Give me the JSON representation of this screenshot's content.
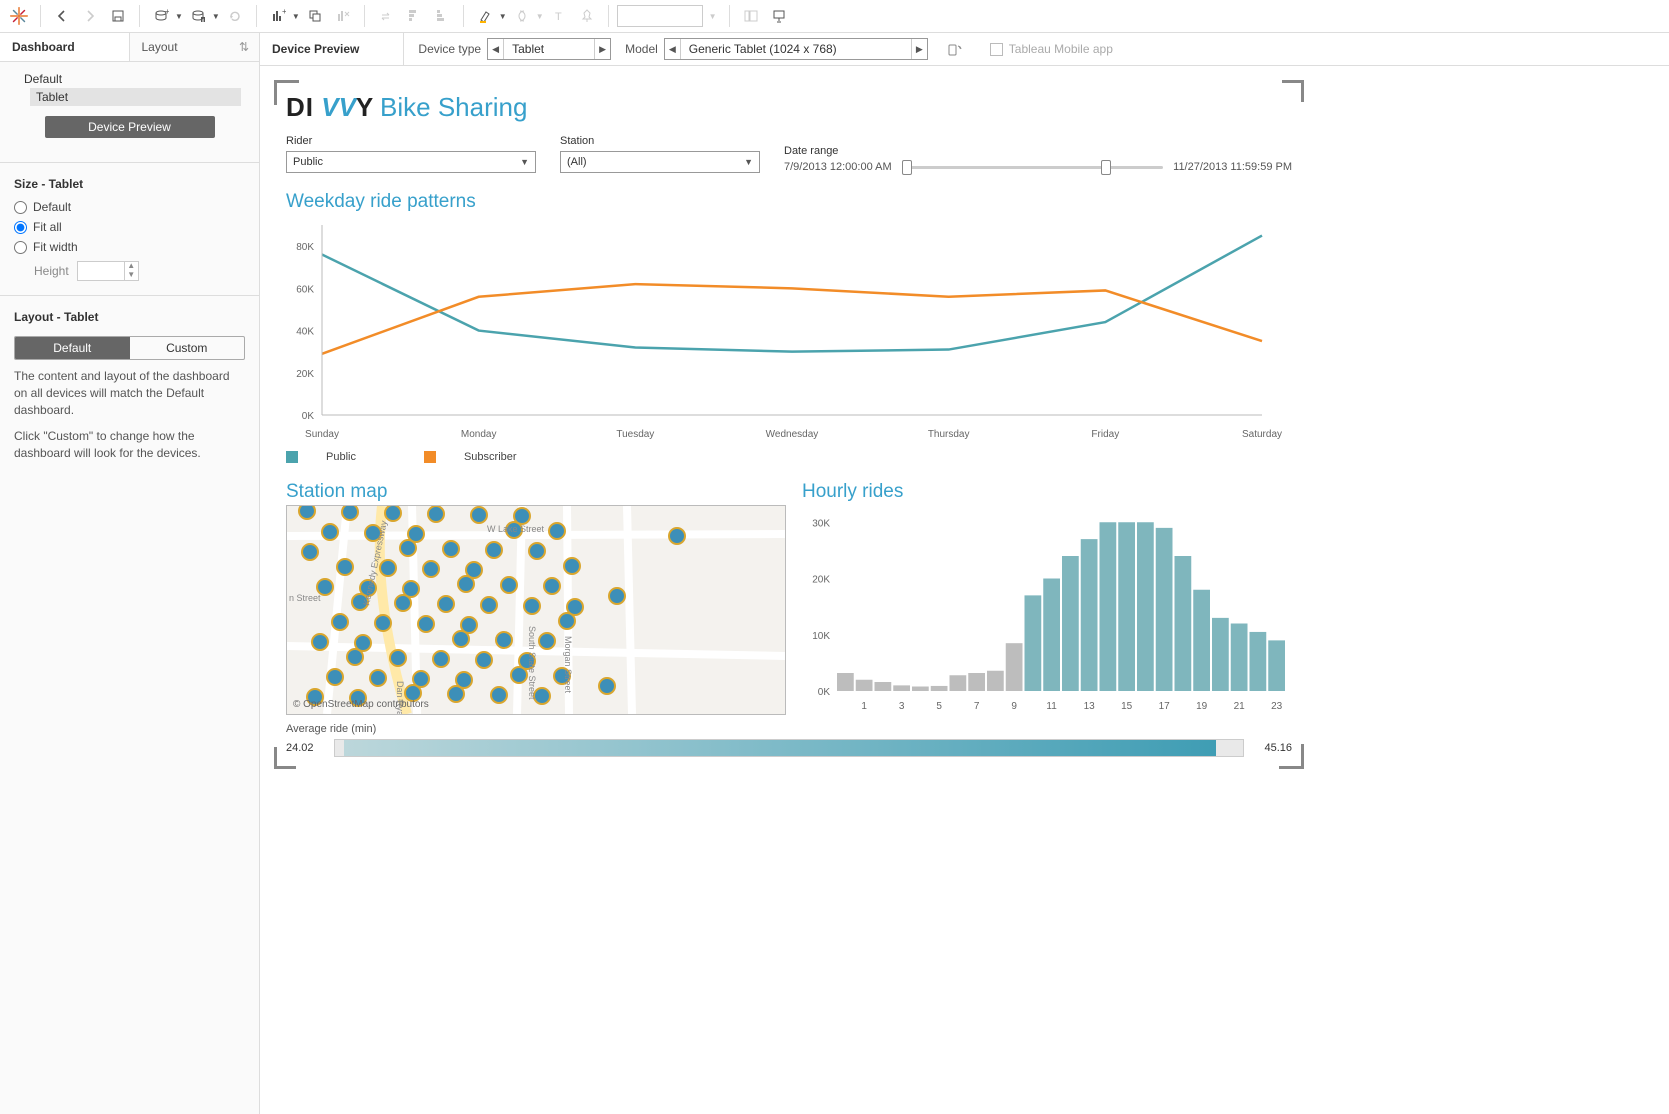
{
  "toolbar": {
    "items": [
      "back",
      "forward",
      "save",
      "new-worksheet",
      "duplicate",
      "refresh",
      "swap",
      "sort-asc",
      "sort-desc"
    ]
  },
  "left_panel": {
    "tabs": {
      "dashboard": "Dashboard",
      "layout": "Layout"
    },
    "device_items": {
      "default": "Default",
      "tablet": "Tablet"
    },
    "preview_button": "Device Preview",
    "size_title": "Size - Tablet",
    "size_options": {
      "default": "Default",
      "fit_all": "Fit all",
      "fit_width": "Fit width"
    },
    "height_label": "Height",
    "layout_title": "Layout - Tablet",
    "layout_toggle": {
      "default": "Default",
      "custom": "Custom"
    },
    "help1": "The content and layout of the dashboard on all devices will match the Default dashboard.",
    "help2": "Click \"Custom\" to change how the dashboard will look for the devices."
  },
  "preview_bar": {
    "title": "Device Preview",
    "device_type_label": "Device type",
    "device_type_value": "Tablet",
    "model_label": "Model",
    "model_value": "Generic Tablet (1024 x 768)",
    "mobile_app": "Tableau Mobile app"
  },
  "dashboard": {
    "title_logo": {
      "di": "DI",
      "vv": " VV",
      "y": "Y ",
      "rest": "Bike Sharing"
    },
    "filters": {
      "rider": {
        "label": "Rider",
        "value": "Public"
      },
      "station": {
        "label": "Station",
        "value": "(All)"
      },
      "date_range": {
        "label": "Date range",
        "start": "7/9/2013 12:00:00 AM",
        "end": "11/27/2013 11:59:59 PM"
      }
    },
    "weekday_title": "Weekday ride patterns",
    "legend": {
      "public": "Public",
      "subscriber": "Subscriber"
    },
    "station_map_title": "Station map",
    "map_credit": "© OpenStreetMap contributors",
    "map_streets": {
      "lake": "W Lake Street",
      "kennedy": "Kennedy Expressway",
      "state": "South State Street",
      "morgan": "Morgan Street",
      "danryan": "Dan Ryan",
      "n": "n Street"
    },
    "hourly_title": "Hourly rides",
    "avg_label": "Average ride (min)",
    "avg_low": "24.02",
    "avg_high": "45.16"
  },
  "chart_data": [
    {
      "type": "line",
      "title": "Weekday ride patterns",
      "categories": [
        "Sunday",
        "Monday",
        "Tuesday",
        "Wednesday",
        "Thursday",
        "Friday",
        "Saturday"
      ],
      "series": [
        {
          "name": "Public",
          "color": "#4ba3ad",
          "values": [
            76000,
            40000,
            32000,
            30000,
            31000,
            44000,
            85000
          ]
        },
        {
          "name": "Subscriber",
          "color": "#f28c28",
          "values": [
            29000,
            56000,
            62000,
            60000,
            56000,
            59000,
            35000
          ]
        }
      ],
      "ylabel": "",
      "xlabel": "",
      "ylim": [
        0,
        90000
      ],
      "yticks": [
        0,
        20000,
        40000,
        60000,
        80000
      ],
      "ytick_labels": [
        "0K",
        "20K",
        "40K",
        "60K",
        "80K"
      ]
    },
    {
      "type": "bar",
      "title": "Hourly rides",
      "categories": [
        0,
        1,
        2,
        3,
        4,
        5,
        6,
        7,
        8,
        9,
        10,
        11,
        12,
        13,
        14,
        15,
        16,
        17,
        18,
        19,
        20,
        21,
        22,
        23
      ],
      "xtick_labels": [
        "",
        "1",
        "",
        "3",
        "",
        "5",
        "",
        "7",
        "",
        "9",
        "",
        "11",
        "",
        "13",
        "",
        "15",
        "",
        "17",
        "",
        "19",
        "",
        "21",
        "",
        "23"
      ],
      "values": [
        3200,
        2000,
        1600,
        1000,
        800,
        900,
        2800,
        3200,
        3600,
        8500,
        17000,
        20000,
        24000,
        27000,
        30000,
        30000,
        30000,
        29000,
        24000,
        18000,
        13000,
        12000,
        10500,
        9000
      ],
      "colors_hint": "bars 0-9 grey, 10-23 teal",
      "ylim": [
        0,
        32000
      ],
      "yticks": [
        0,
        10000,
        20000,
        30000
      ],
      "ytick_labels": [
        "0K",
        "10K",
        "20K",
        "30K"
      ]
    }
  ]
}
